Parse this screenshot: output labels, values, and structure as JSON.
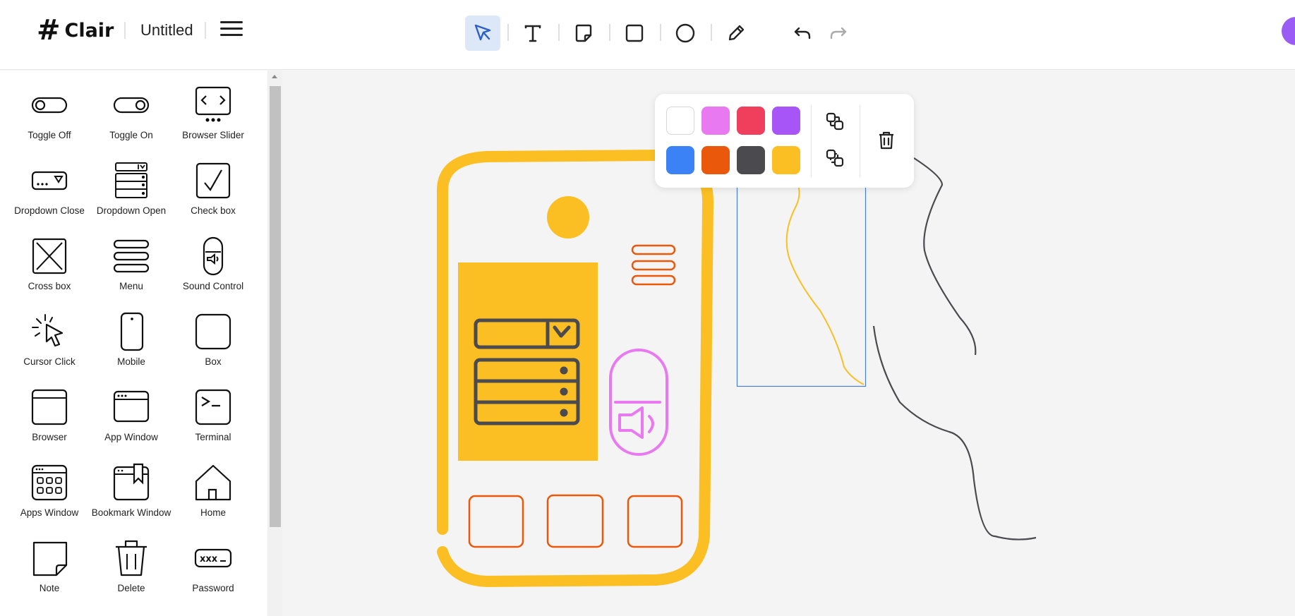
{
  "app": {
    "name": "Clair",
    "logo_glyph": "#",
    "document_title": "Untitled"
  },
  "toolbar": {
    "tools": [
      {
        "name": "select",
        "icon": "cursor-arrow-icon",
        "active": true
      },
      {
        "name": "text",
        "icon": "text-T-icon",
        "active": false
      },
      {
        "name": "sticky-note",
        "icon": "note-icon",
        "active": false
      },
      {
        "name": "rectangle",
        "icon": "square-icon",
        "active": false
      },
      {
        "name": "ellipse",
        "icon": "circle-icon",
        "active": false
      },
      {
        "name": "pencil",
        "icon": "pencil-icon",
        "active": false
      }
    ],
    "undo": "undo-icon",
    "redo": "redo-icon"
  },
  "sidebar": {
    "items": [
      {
        "label": "Toggle Off",
        "icon": "toggle-off-icon"
      },
      {
        "label": "Toggle On",
        "icon": "toggle-on-icon"
      },
      {
        "label": "Browser Slider",
        "icon": "browser-slider-icon"
      },
      {
        "label": "Dropdown Close",
        "icon": "dropdown-close-icon"
      },
      {
        "label": "Dropdown Open",
        "icon": "dropdown-open-icon"
      },
      {
        "label": "Check box",
        "icon": "check-box-icon"
      },
      {
        "label": "Cross box",
        "icon": "cross-box-icon"
      },
      {
        "label": "Menu",
        "icon": "menu-icon"
      },
      {
        "label": "Sound Control",
        "icon": "sound-control-icon"
      },
      {
        "label": "Cursor Click",
        "icon": "cursor-click-icon"
      },
      {
        "label": "Mobile",
        "icon": "mobile-icon"
      },
      {
        "label": "Box",
        "icon": "box-icon"
      },
      {
        "label": "Browser",
        "icon": "browser-icon"
      },
      {
        "label": "App Window",
        "icon": "app-window-icon"
      },
      {
        "label": "Terminal",
        "icon": "terminal-icon"
      },
      {
        "label": "Apps Window",
        "icon": "apps-window-icon"
      },
      {
        "label": "Bookmark Window",
        "icon": "bookmark-window-icon"
      },
      {
        "label": "Home",
        "icon": "home-icon"
      },
      {
        "label": "Note",
        "icon": "note-icon"
      },
      {
        "label": "Delete",
        "icon": "delete-icon"
      },
      {
        "label": "Password",
        "icon": "password-icon"
      }
    ]
  },
  "palette": {
    "colors": [
      "#ffffff",
      "#e879f0",
      "#f03e5d",
      "#a855f7",
      "#3b82f6",
      "#ea580c",
      "#4a4a4f",
      "#fbbf24"
    ],
    "actions": [
      "bring-forward-icon",
      "send-backward-icon",
      "trash-icon"
    ]
  },
  "colors": {
    "accent": "#dce7f8",
    "selection": "#4a7fd4",
    "yellow": "#fbbf24",
    "orange": "#ea580c",
    "pink": "#e879f0",
    "dark": "#4a4a4f",
    "avatar": "#9b5cf6"
  }
}
